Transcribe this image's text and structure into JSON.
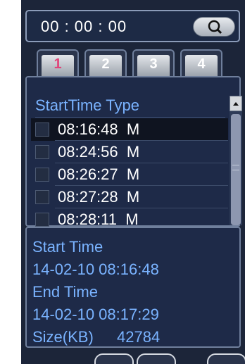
{
  "search": {
    "time_value": "00 : 00 : 00",
    "icon": "search-icon"
  },
  "tabs": [
    {
      "label": "1",
      "active": true
    },
    {
      "label": "2",
      "active": false
    },
    {
      "label": "3",
      "active": false
    },
    {
      "label": "4",
      "active": false
    }
  ],
  "list": {
    "header": "StartTime Type",
    "rows": [
      {
        "text": "08:16:48  M",
        "selected": true
      },
      {
        "text": "08:24:56  M",
        "selected": false
      },
      {
        "text": "08:26:27  M",
        "selected": false
      },
      {
        "text": "08:27:28  M",
        "selected": false
      },
      {
        "text": "08:28:11  M",
        "selected": false
      }
    ]
  },
  "info": {
    "start_time_label": "Start Time",
    "start_time_value": "14-02-10  08:16:48",
    "end_time_label": "End Time",
    "end_time_value": "14-02-10  08:17:29",
    "size_label": "Size(KB)",
    "size_value": "42784"
  },
  "colors": {
    "panel_bg": "#1c2539",
    "label_blue": "#7ab3ff",
    "active_tab_text": "#e0457a"
  }
}
